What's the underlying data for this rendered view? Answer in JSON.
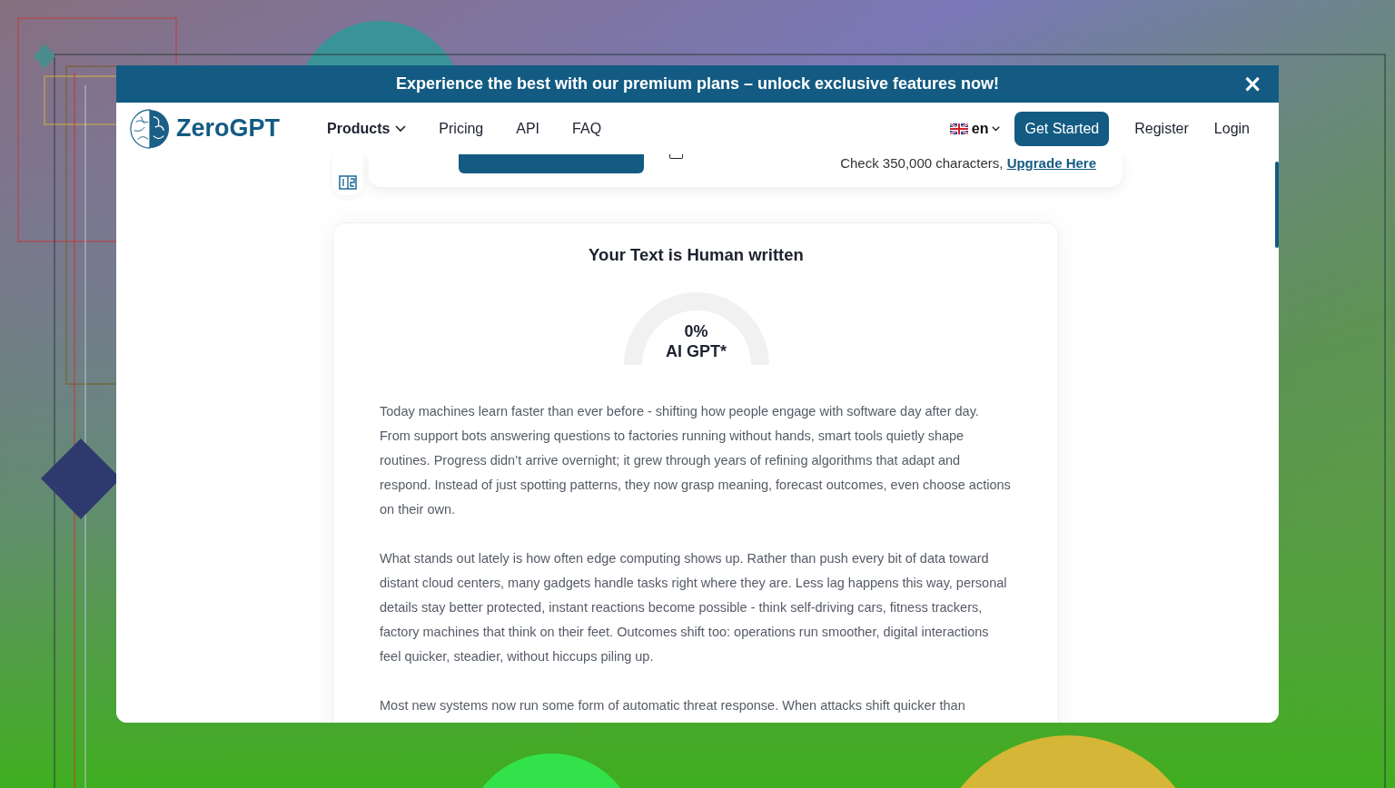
{
  "banner": {
    "text": "Experience the best with our premium plans – unlock exclusive features now!",
    "close": "×"
  },
  "header": {
    "logo": "ZeroGPT",
    "nav": [
      {
        "label": "Products",
        "kind": "dropdown"
      },
      {
        "label": "Pricing",
        "kind": "link"
      },
      {
        "label": "API",
        "kind": "link"
      },
      {
        "label": "FAQ",
        "kind": "link"
      }
    ],
    "language": "en",
    "cta": "Get Started",
    "links": [
      "Register",
      "Login"
    ]
  },
  "detector": {
    "limit_text": "Check 350,000 characters,",
    "upgrade_link": "Upgrade Here",
    "upload_checked": false
  },
  "result": {
    "title": "Your Text is Human written",
    "score": "0%",
    "score_label": "AI GPT*",
    "paragraphs": [
      "Today machines learn faster than ever before - shifting how people engage with software day after day. From support bots answering questions to factories running without hands, smart tools quietly shape routines. Progress didn’t arrive overnight; it grew through years of refining algorithms that adapt and respond. Instead of just spotting patterns, they now grasp meaning, forecast outcomes, even choose actions on their own.",
      "What stands out lately is how often edge computing shows up. Rather than push every bit of data toward distant cloud centers, many gadgets handle tasks right where they are. Less lag happens this way, personal details stay better protected, instant reactions become possible - think self-driving cars, fitness trackers, factory machines that think on their feet. Outcomes shift too: operations run smoother, digital interactions feel quicker, steadier, without hiccups piling up.",
      "Most new systems now run some form of automatic threat response. When attacks shift quicker than"
    ]
  }
}
